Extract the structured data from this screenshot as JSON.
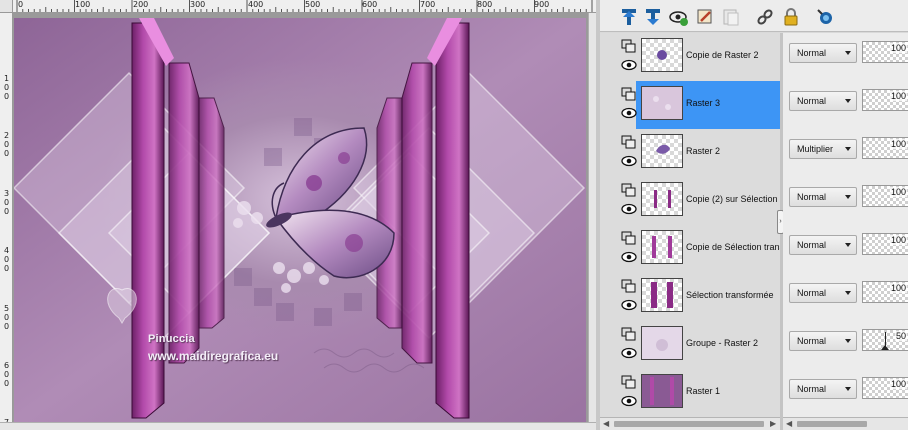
{
  "canvas": {
    "ruler_top_ticks": [
      "0",
      "100",
      "200",
      "300",
      "400",
      "500",
      "600",
      "700",
      "800",
      "900"
    ],
    "ruler_left_digits": [
      "1",
      "0",
      "0",
      "2",
      "0",
      "0",
      "3",
      "0",
      "0",
      "4",
      "0",
      "0",
      "5",
      "0",
      "0",
      "6",
      "0",
      "0",
      "7"
    ],
    "watermark_name": "Pinuccia",
    "watermark_url": "www.maidiregrafica.eu"
  },
  "toolbar": {
    "icons": [
      "new-raster-layer-icon",
      "new-vector-layer-icon",
      "view-layer-icon",
      "edit-selection-icon",
      "new-mask-icon",
      "link-icon",
      "lock-icon",
      "layer-styles-icon"
    ]
  },
  "layers": [
    {
      "name": "Copie de Raster 2",
      "blend_mode": "Normal",
      "opacity": "100",
      "selected": false
    },
    {
      "name": "Raster 3",
      "blend_mode": "Normal",
      "opacity": "100",
      "selected": true
    },
    {
      "name": "Raster 2",
      "blend_mode": "Multiplier",
      "opacity": "100",
      "selected": false
    },
    {
      "name": "Copie (2) sur Sélection t",
      "blend_mode": "Normal",
      "opacity": "100",
      "selected": false
    },
    {
      "name": "Copie de Sélection trans",
      "blend_mode": "Normal",
      "opacity": "100",
      "selected": false
    },
    {
      "name": "Sélection transformée",
      "blend_mode": "Normal",
      "opacity": "100",
      "selected": false
    },
    {
      "name": "Groupe - Raster 2",
      "blend_mode": "Normal",
      "opacity": "50",
      "selected": false
    },
    {
      "name": "Raster 1",
      "blend_mode": "Normal",
      "opacity": "100",
      "selected": false
    }
  ],
  "colors": {
    "selection": "#3d95f5",
    "magenta": "#b04aa8",
    "background_purple": "#a27aa6"
  }
}
